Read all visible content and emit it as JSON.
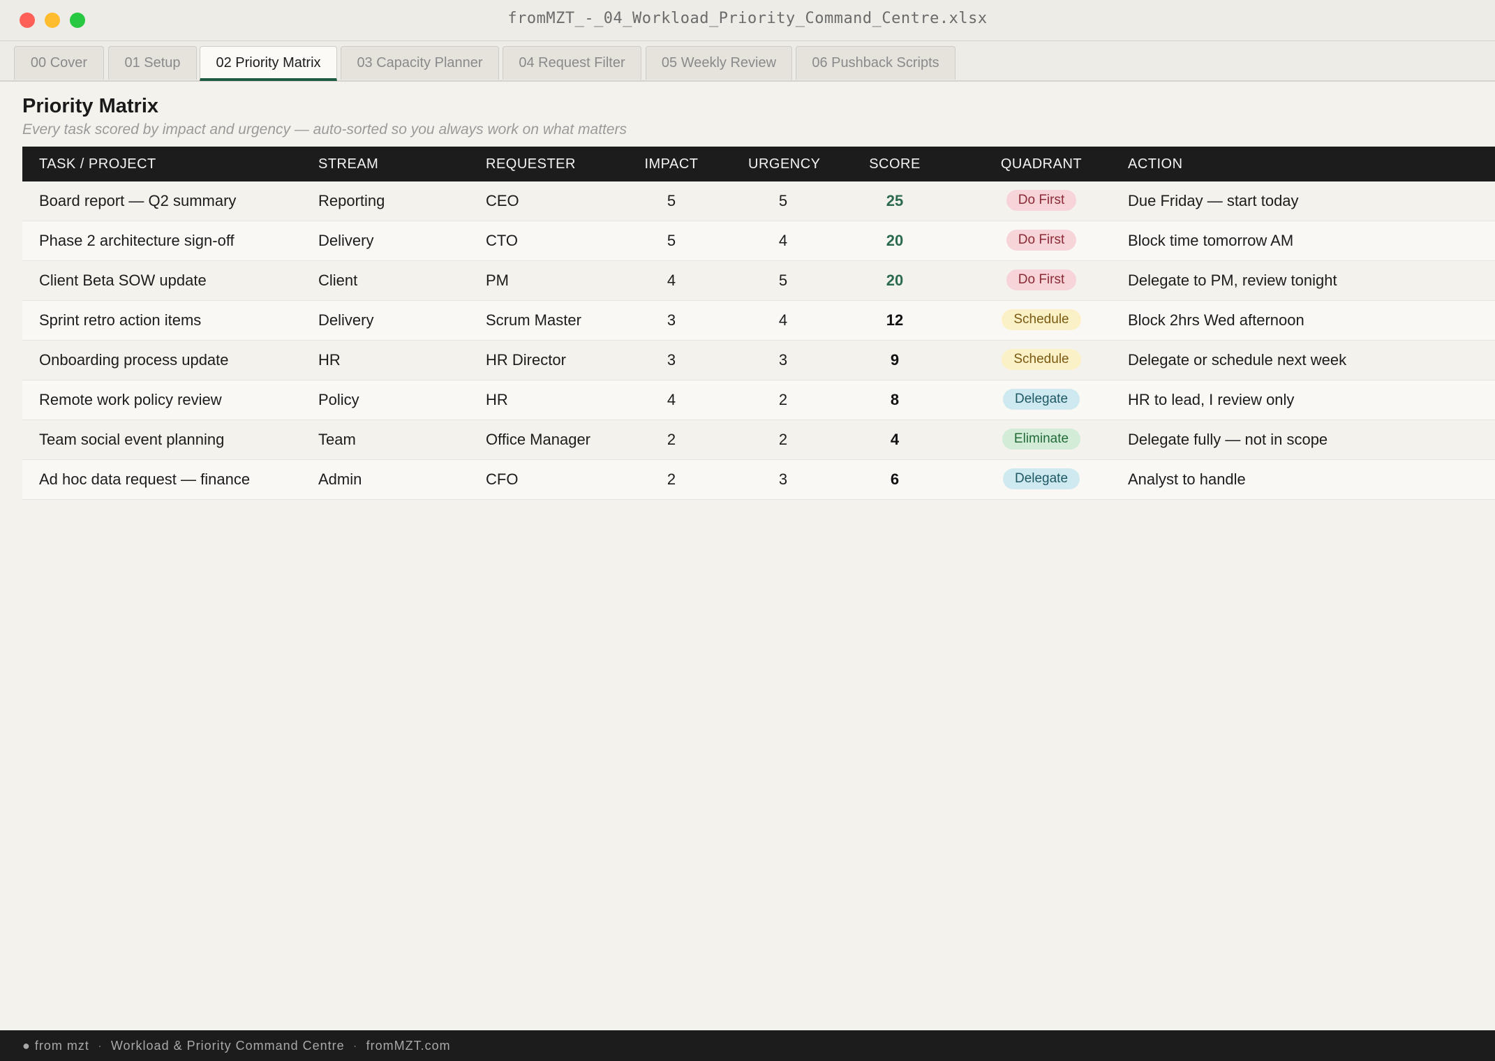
{
  "window": {
    "title": "fromMZT_-_04_Workload_Priority_Command_Centre.xlsx"
  },
  "tabs": [
    {
      "label": "00 Cover",
      "active": false
    },
    {
      "label": "01 Setup",
      "active": false
    },
    {
      "label": "02 Priority Matrix",
      "active": true
    },
    {
      "label": "03 Capacity Planner",
      "active": false
    },
    {
      "label": "04 Request Filter",
      "active": false
    },
    {
      "label": "05 Weekly Review",
      "active": false
    },
    {
      "label": "06 Pushback Scripts",
      "active": false
    }
  ],
  "sheet": {
    "title": "Priority Matrix",
    "subtitle": "Every task scored by impact and urgency — auto-sorted so you always work on what matters"
  },
  "table": {
    "headers": [
      "TASK / PROJECT",
      "STREAM",
      "REQUESTER",
      "IMPACT",
      "URGENCY",
      "SCORE",
      "QUADRANT",
      "ACTION"
    ],
    "rows": [
      {
        "task": "Board report — Q2 summary",
        "stream": "Reporting",
        "requester": "CEO",
        "impact": "5",
        "urgency": "5",
        "score": "25",
        "quadrant": "Do First",
        "action": "Due Friday — start today"
      },
      {
        "task": "Phase 2 architecture sign-off",
        "stream": "Delivery",
        "requester": "CTO",
        "impact": "5",
        "urgency": "4",
        "score": "20",
        "quadrant": "Do First",
        "action": "Block time tomorrow AM"
      },
      {
        "task": "Client Beta SOW update",
        "stream": "Client",
        "requester": "PM",
        "impact": "4",
        "urgency": "5",
        "score": "20",
        "quadrant": "Do First",
        "action": "Delegate to PM, review tonight"
      },
      {
        "task": "Sprint retro action items",
        "stream": "Delivery",
        "requester": "Scrum Master",
        "impact": "3",
        "urgency": "4",
        "score": "12",
        "quadrant": "Schedule",
        "action": "Block 2hrs Wed afternoon"
      },
      {
        "task": "Onboarding process update",
        "stream": "HR",
        "requester": "HR Director",
        "impact": "3",
        "urgency": "3",
        "score": "9",
        "quadrant": "Schedule",
        "action": "Delegate or schedule next week"
      },
      {
        "task": "Remote work policy review",
        "stream": "Policy",
        "requester": "HR",
        "impact": "4",
        "urgency": "2",
        "score": "8",
        "quadrant": "Delegate",
        "action": "HR to lead, I review only"
      },
      {
        "task": "Team social event planning",
        "stream": "Team",
        "requester": "Office Manager",
        "impact": "2",
        "urgency": "2",
        "score": "4",
        "quadrant": "Eliminate",
        "action": "Delegate fully — not in scope"
      },
      {
        "task": "Ad hoc data request — finance",
        "stream": "Admin",
        "requester": "CFO",
        "impact": "2",
        "urgency": "3",
        "score": "6",
        "quadrant": "Delegate",
        "action": "Analyst to handle"
      }
    ]
  },
  "footer": {
    "brand": "● from mzt",
    "separator": "·",
    "product": "Workload & Priority Command Centre",
    "site": "fromMZT.com"
  },
  "colors": {
    "accent": "#1f5c44",
    "score_high": "#2b6a4c",
    "header_bg": "#1c1c1c",
    "do_first_bg": "#f7d4d8",
    "schedule_bg": "#fbf1c7",
    "delegate_bg": "#cfe9f0",
    "eliminate_bg": "#d3ecd8"
  }
}
